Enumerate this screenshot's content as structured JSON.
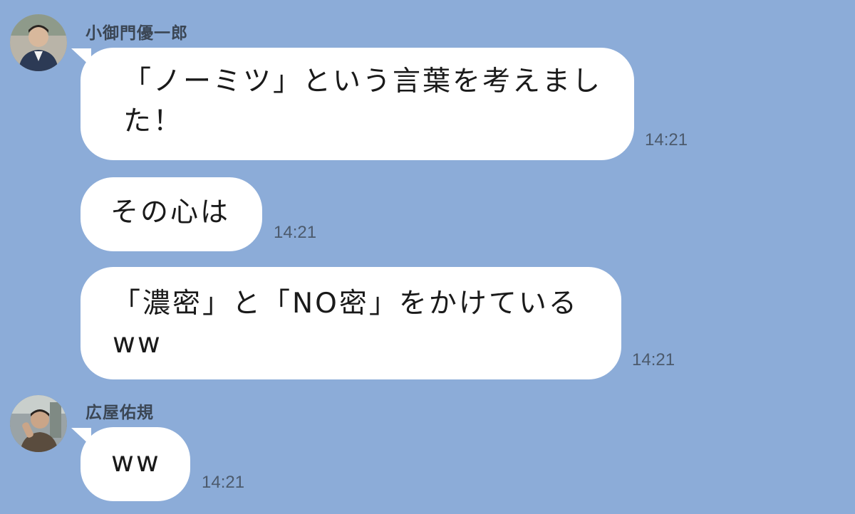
{
  "chat": {
    "messages": [
      {
        "sender": "小御門優一郎",
        "lines": [
          "「ノーミツ」という言葉を考えまし",
          "た！"
        ],
        "time": "14:21"
      },
      {
        "sender": "",
        "lines": [
          "その心は"
        ],
        "time": "14:21"
      },
      {
        "sender": "",
        "lines": [
          "「濃密」と「NO密」をかけている",
          "ww"
        ],
        "time": "14:21"
      },
      {
        "sender": "広屋佑規",
        "lines": [
          "ww"
        ],
        "time": "14:21"
      }
    ]
  },
  "icons": {
    "avatar1": "user-avatar-icon",
    "avatar2": "user-avatar-icon"
  },
  "colors": {
    "background": "#8cacd8",
    "bubble": "#ffffff",
    "name_text": "#3b4654",
    "time_text": "#4c5a6c"
  }
}
